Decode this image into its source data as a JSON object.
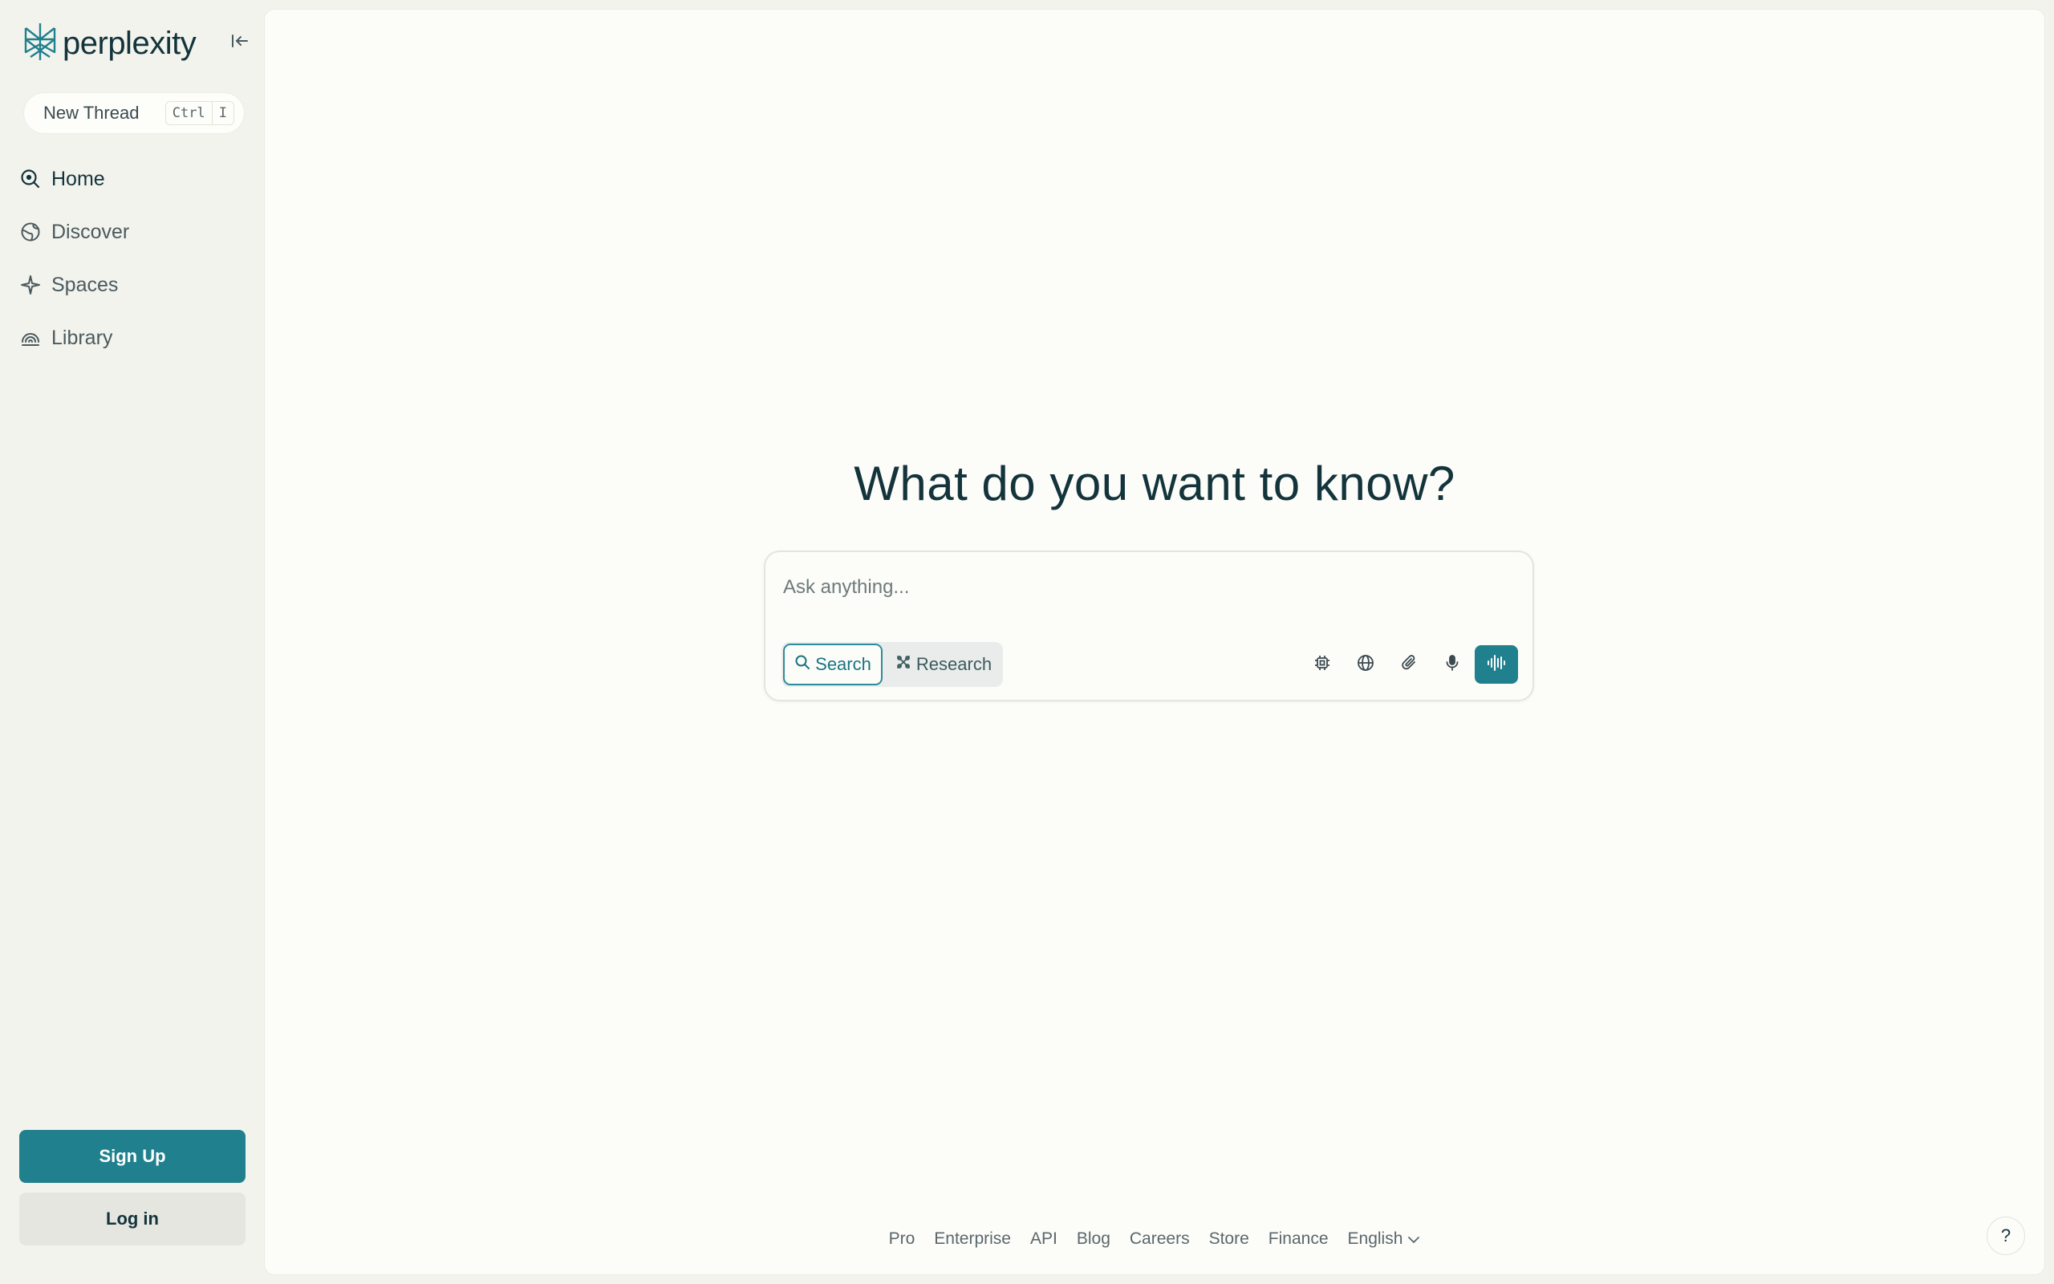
{
  "app": {
    "logo_text": "perplexity",
    "brand_color": "#20808d"
  },
  "sidebar": {
    "collapse_icon": "collapse-sidebar-icon",
    "new_thread": {
      "label": "New Thread",
      "shortcut_keys": [
        "Ctrl",
        "I"
      ]
    },
    "items": [
      {
        "label": "Home",
        "icon": "home-search-icon",
        "active": true
      },
      {
        "label": "Discover",
        "icon": "globe-icon",
        "active": false
      },
      {
        "label": "Spaces",
        "icon": "spaces-icon",
        "active": false
      },
      {
        "label": "Library",
        "icon": "library-icon",
        "active": false
      }
    ],
    "signup_label": "Sign Up",
    "login_label": "Log in"
  },
  "main": {
    "headline": "What do you want to know?",
    "ask": {
      "placeholder": "Ask anything...",
      "modes": {
        "search_label": "Search",
        "research_label": "Research",
        "selected": "Search"
      },
      "tools": [
        "model-chip-icon",
        "globe-icon",
        "paperclip-icon",
        "microphone-icon",
        "voice-mode-icon"
      ]
    }
  },
  "footer": {
    "links": [
      "Pro",
      "Enterprise",
      "API",
      "Blog",
      "Careers",
      "Store",
      "Finance"
    ],
    "language": "English"
  },
  "help_label": "?"
}
